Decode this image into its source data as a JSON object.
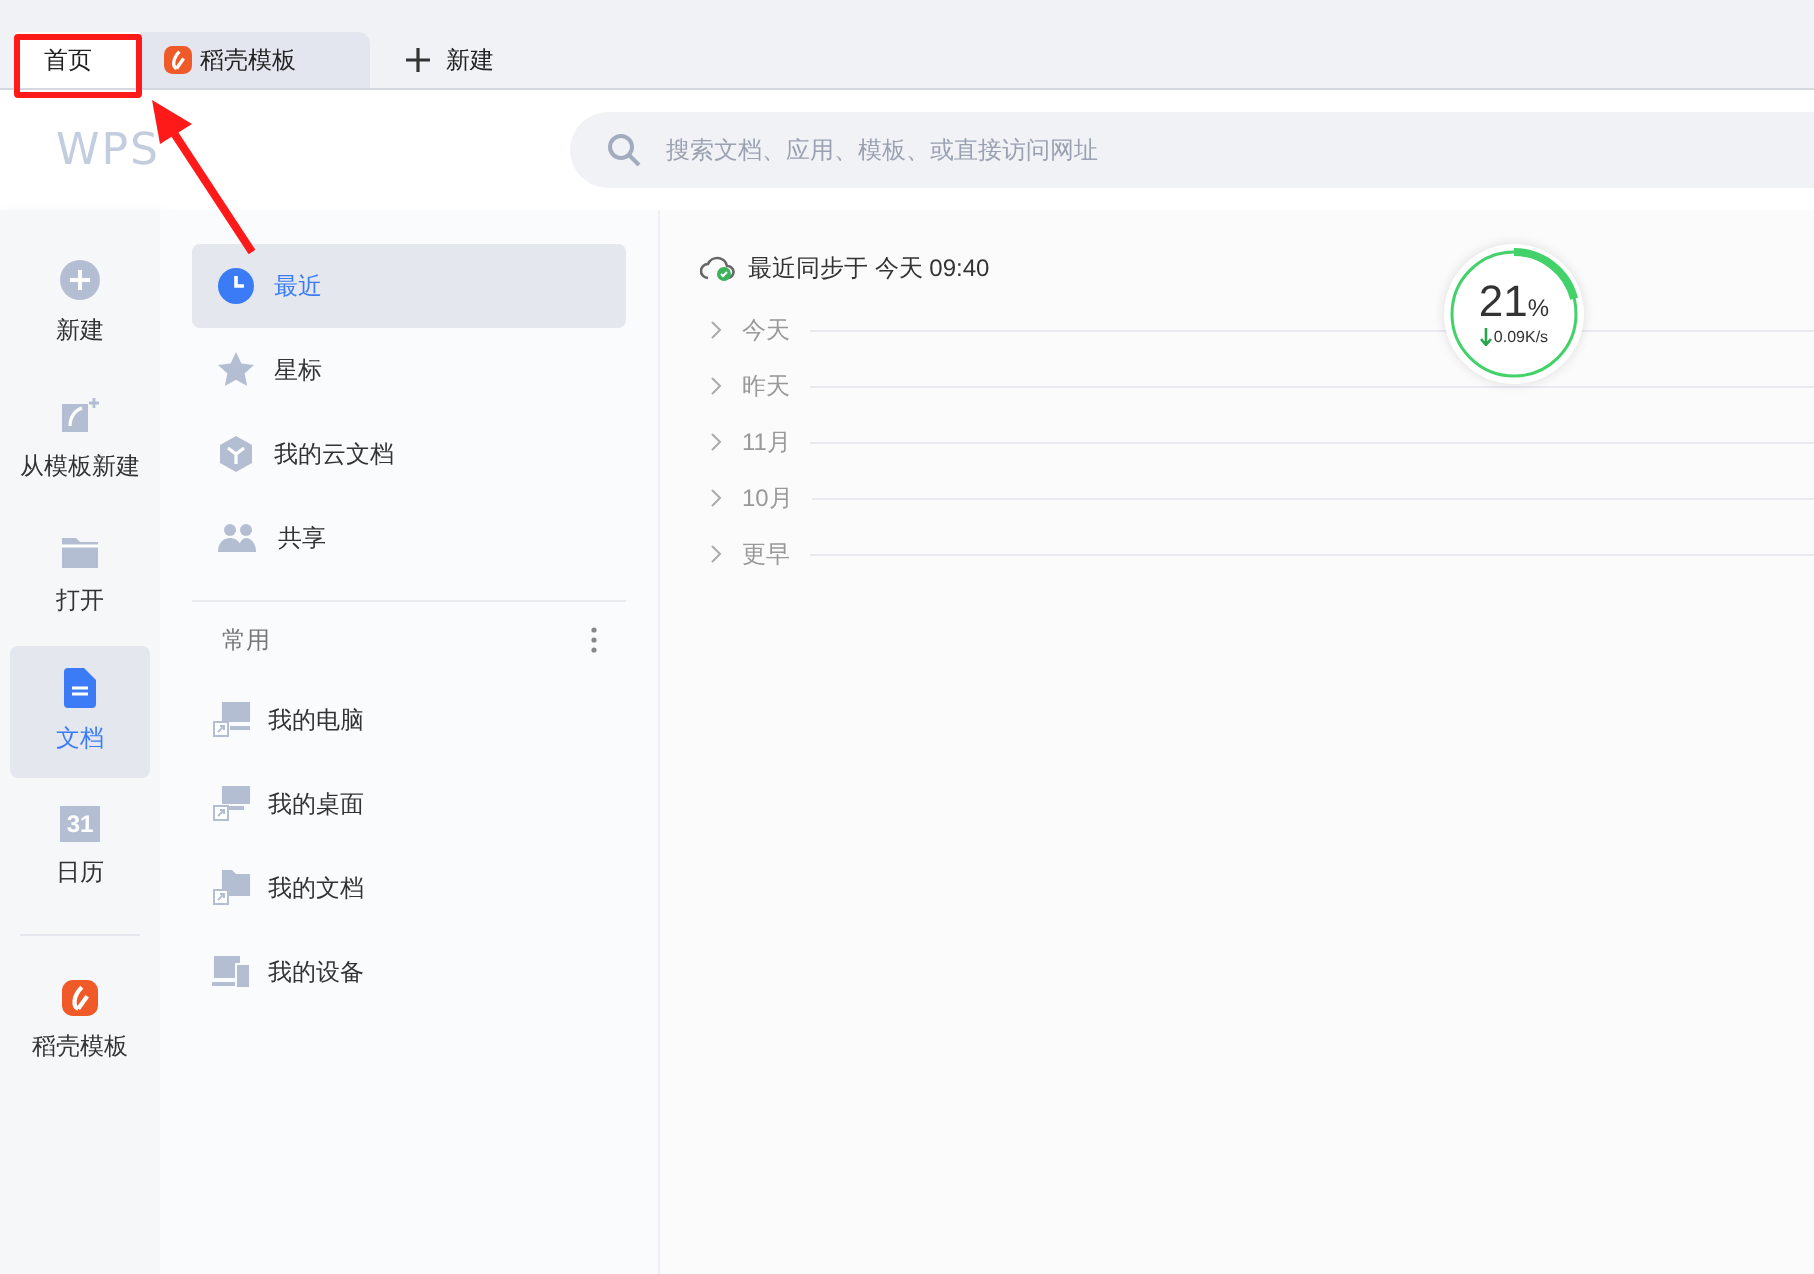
{
  "tabs": [
    {
      "label": "首页",
      "selected": true,
      "kind": "home"
    },
    {
      "label": "稻壳模板",
      "selected": false,
      "kind": "docer"
    }
  ],
  "new_tab": {
    "label": "新建"
  },
  "logo": "WPS",
  "search": {
    "placeholder": "搜索文档、应用、模板、或直接访问网址"
  },
  "rail": [
    {
      "label": "新建",
      "kind": "new",
      "selected": false
    },
    {
      "label": "从模板新建",
      "kind": "template",
      "selected": false
    },
    {
      "label": "打开",
      "kind": "open",
      "selected": false
    },
    {
      "label": "文档",
      "kind": "docs",
      "selected": true
    },
    {
      "label": "日历",
      "kind": "calendar",
      "selected": false,
      "icon_text": "31"
    },
    {
      "label": "稻壳模板",
      "kind": "docer",
      "selected": false
    }
  ],
  "nav": [
    {
      "label": "最近",
      "kind": "recent",
      "selected": true
    },
    {
      "label": "星标",
      "kind": "star",
      "selected": false
    },
    {
      "label": "我的云文档",
      "kind": "cloud",
      "selected": false
    },
    {
      "label": "共享",
      "kind": "share",
      "selected": false
    }
  ],
  "section": {
    "title": "常用"
  },
  "places": [
    {
      "label": "我的电脑",
      "kind": "computer"
    },
    {
      "label": "我的桌面",
      "kind": "desktop"
    },
    {
      "label": "我的文档",
      "kind": "folder"
    },
    {
      "label": "我的设备",
      "kind": "devices"
    }
  ],
  "sync_status": "最近同步于 今天 09:40",
  "groups": [
    {
      "label": "今天",
      "expanded": false
    },
    {
      "label": "昨天",
      "expanded": false
    },
    {
      "label": "11月",
      "expanded": false
    },
    {
      "label": "10月",
      "expanded": false
    },
    {
      "label": "更早",
      "expanded": false
    }
  ],
  "speed_meter": {
    "value": "21",
    "unit": "%",
    "speed": "0.09K/s",
    "level": 0.21
  },
  "annotation": {
    "kind": "box-arrow"
  }
}
